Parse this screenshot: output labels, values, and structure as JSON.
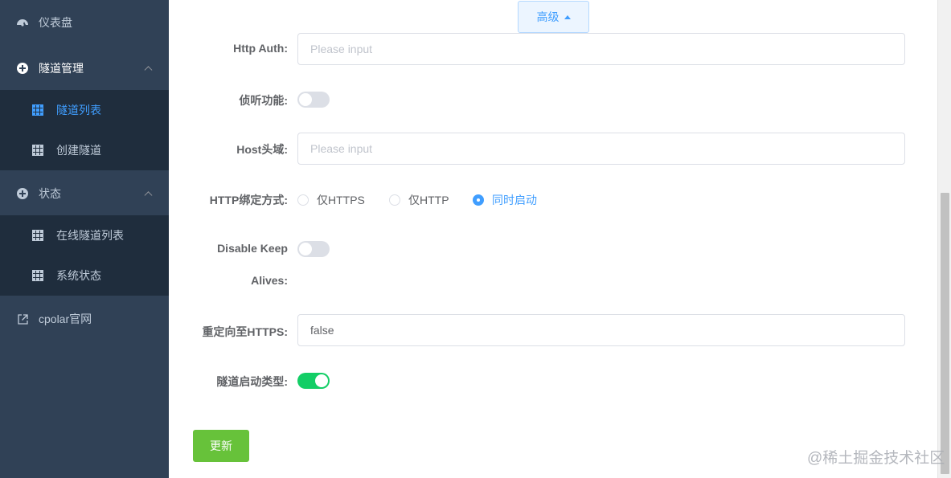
{
  "sidebar": {
    "items": [
      {
        "label": "仪表盘",
        "icon": "dashboard-icon"
      },
      {
        "label": "隧道管理",
        "icon": "plus-circle-icon"
      },
      {
        "label": "隧道列表",
        "icon": "grid-icon"
      },
      {
        "label": "创建隧道",
        "icon": "grid-icon"
      },
      {
        "label": "状态",
        "icon": "plus-circle-icon"
      },
      {
        "label": "在线隧道列表",
        "icon": "grid-icon"
      },
      {
        "label": "系统状态",
        "icon": "grid-icon"
      },
      {
        "label": "cpolar官网",
        "icon": "external-link-icon"
      }
    ],
    "active_item": "隧道列表",
    "colors": {
      "bg": "#304156",
      "submenu_bg": "#1f2d3d",
      "active": "#409eff"
    }
  },
  "form": {
    "advanced_button": "高级",
    "http_auth": {
      "label": "Http Auth:",
      "placeholder": "Please input",
      "value": ""
    },
    "listen": {
      "label": "侦听功能:",
      "enabled": false
    },
    "host_header": {
      "label": "Host头域:",
      "placeholder": "Please input",
      "value": ""
    },
    "http_bind": {
      "label": "HTTP绑定方式:",
      "options": [
        "仅HTTPS",
        "仅HTTP",
        "同时启动"
      ],
      "selected": "同时启动"
    },
    "disable_keep_alives": {
      "label_line1": "Disable Keep",
      "label_line2": "Alives:",
      "enabled": false
    },
    "redirect_https": {
      "label": "重定向至HTTPS:",
      "value": "false"
    },
    "tunnel_start_type": {
      "label": "隧道启动类型:",
      "enabled": true
    },
    "submit_button": "更新"
  },
  "watermark": "@稀土掘金技术社区",
  "colors": {
    "primary": "#409eff",
    "success": "#67c23a",
    "switch_on": "#13ce66"
  }
}
